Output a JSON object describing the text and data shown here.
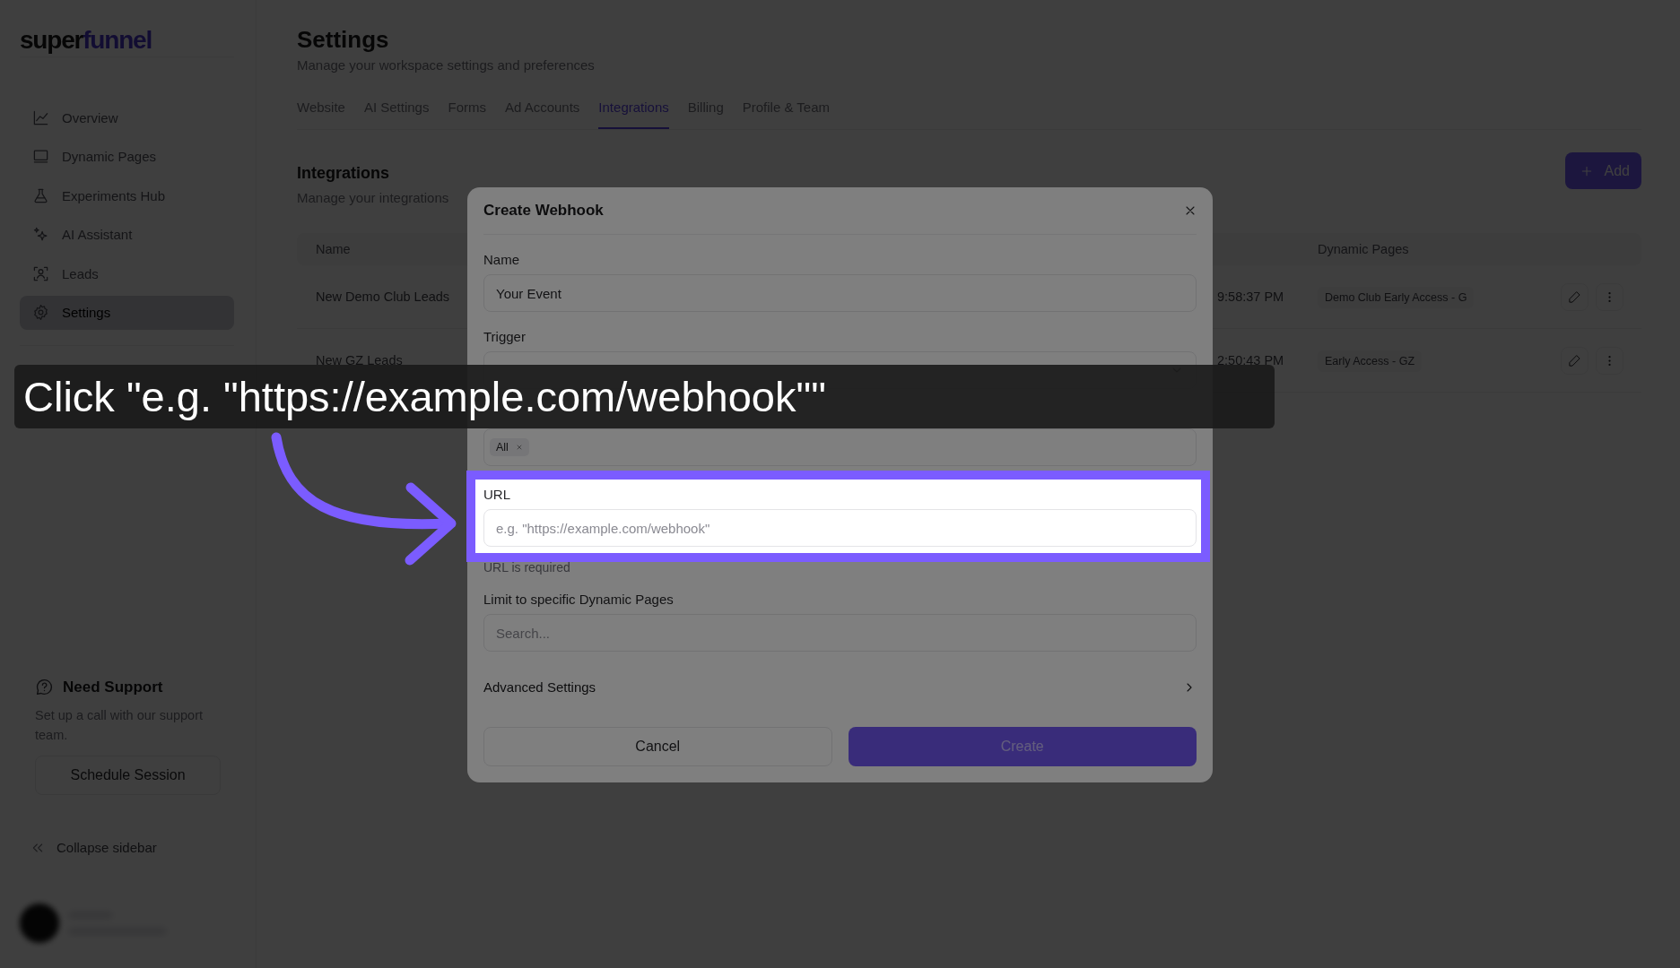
{
  "sidebar": {
    "logo": {
      "dark": "super",
      "accent": "funnel"
    },
    "nav": [
      {
        "label": "Overview",
        "selected": false
      },
      {
        "label": "Dynamic Pages",
        "selected": false
      },
      {
        "label": "Experiments Hub",
        "selected": false
      },
      {
        "label": "AI Assistant",
        "selected": false
      },
      {
        "label": "Leads",
        "selected": false
      },
      {
        "label": "Settings",
        "selected": true
      }
    ],
    "support": {
      "title": "Need Support",
      "text": "Set up a call with our support team.",
      "button": "Schedule Session"
    },
    "collapse": "Collapse sidebar"
  },
  "header": {
    "title": "Settings",
    "subtitle": "Manage your workspace settings and preferences"
  },
  "tabs": [
    {
      "label": "Website",
      "selected": false
    },
    {
      "label": "AI Settings",
      "selected": false
    },
    {
      "label": "Forms",
      "selected": false
    },
    {
      "label": "Ad Accounts",
      "selected": false
    },
    {
      "label": "Integrations",
      "selected": true
    },
    {
      "label": "Billing",
      "selected": false
    },
    {
      "label": "Profile & Team",
      "selected": false
    }
  ],
  "section": {
    "title": "Integrations",
    "subtitle": "Manage your integrations",
    "add_button": "Add"
  },
  "table": {
    "columns": [
      "Name",
      "Dynamic Pages"
    ],
    "rows": [
      {
        "name": "New Demo Club Leads",
        "time": "9:58:37 PM",
        "page": "Demo Club Early Access - G"
      },
      {
        "name": "New GZ Leads",
        "time": "2:50:43 PM",
        "page": "Early Access - GZ"
      }
    ]
  },
  "modal": {
    "title": "Create Webhook",
    "fields": [
      {
        "kind": "text",
        "label": "Name",
        "value": "Your Event"
      },
      {
        "kind": "select",
        "label": "Trigger"
      },
      {
        "kind": "tags",
        "tags": [
          "All"
        ]
      },
      {
        "kind": "text",
        "label": "URL",
        "placeholder": "e.g. \"https://example.com/webhook\"",
        "error": "URL is required",
        "highlighted": true
      },
      {
        "kind": "text",
        "label": "Limit to specific Dynamic Pages",
        "placeholder": "Search..."
      }
    ],
    "advanced": "Advanced Settings",
    "buttons": [
      {
        "label": "Cancel",
        "kind": "secondary",
        "disabled": false
      },
      {
        "label": "Create",
        "kind": "primary",
        "disabled": true
      }
    ]
  },
  "annotation": {
    "caption": "Click \"e.g. \"https://example.com/webhook\"\""
  }
}
